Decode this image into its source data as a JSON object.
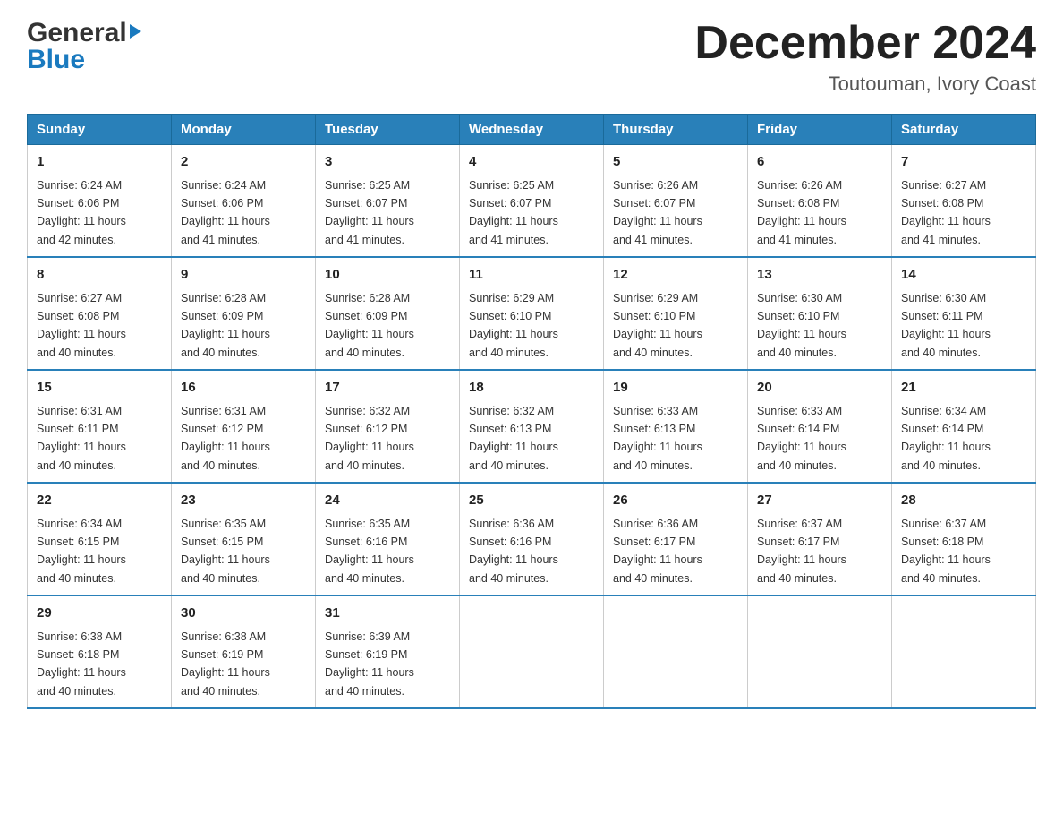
{
  "logo": {
    "general": "General",
    "blue": "Blue"
  },
  "header": {
    "month": "December 2024",
    "location": "Toutouman, Ivory Coast"
  },
  "weekdays": [
    "Sunday",
    "Monday",
    "Tuesday",
    "Wednesday",
    "Thursday",
    "Friday",
    "Saturday"
  ],
  "weeks": [
    [
      {
        "day": "1",
        "sunrise": "6:24 AM",
        "sunset": "6:06 PM",
        "daylight": "11 hours and 42 minutes."
      },
      {
        "day": "2",
        "sunrise": "6:24 AM",
        "sunset": "6:06 PM",
        "daylight": "11 hours and 41 minutes."
      },
      {
        "day": "3",
        "sunrise": "6:25 AM",
        "sunset": "6:07 PM",
        "daylight": "11 hours and 41 minutes."
      },
      {
        "day": "4",
        "sunrise": "6:25 AM",
        "sunset": "6:07 PM",
        "daylight": "11 hours and 41 minutes."
      },
      {
        "day": "5",
        "sunrise": "6:26 AM",
        "sunset": "6:07 PM",
        "daylight": "11 hours and 41 minutes."
      },
      {
        "day": "6",
        "sunrise": "6:26 AM",
        "sunset": "6:08 PM",
        "daylight": "11 hours and 41 minutes."
      },
      {
        "day": "7",
        "sunrise": "6:27 AM",
        "sunset": "6:08 PM",
        "daylight": "11 hours and 41 minutes."
      }
    ],
    [
      {
        "day": "8",
        "sunrise": "6:27 AM",
        "sunset": "6:08 PM",
        "daylight": "11 hours and 40 minutes."
      },
      {
        "day": "9",
        "sunrise": "6:28 AM",
        "sunset": "6:09 PM",
        "daylight": "11 hours and 40 minutes."
      },
      {
        "day": "10",
        "sunrise": "6:28 AM",
        "sunset": "6:09 PM",
        "daylight": "11 hours and 40 minutes."
      },
      {
        "day": "11",
        "sunrise": "6:29 AM",
        "sunset": "6:10 PM",
        "daylight": "11 hours and 40 minutes."
      },
      {
        "day": "12",
        "sunrise": "6:29 AM",
        "sunset": "6:10 PM",
        "daylight": "11 hours and 40 minutes."
      },
      {
        "day": "13",
        "sunrise": "6:30 AM",
        "sunset": "6:10 PM",
        "daylight": "11 hours and 40 minutes."
      },
      {
        "day": "14",
        "sunrise": "6:30 AM",
        "sunset": "6:11 PM",
        "daylight": "11 hours and 40 minutes."
      }
    ],
    [
      {
        "day": "15",
        "sunrise": "6:31 AM",
        "sunset": "6:11 PM",
        "daylight": "11 hours and 40 minutes."
      },
      {
        "day": "16",
        "sunrise": "6:31 AM",
        "sunset": "6:12 PM",
        "daylight": "11 hours and 40 minutes."
      },
      {
        "day": "17",
        "sunrise": "6:32 AM",
        "sunset": "6:12 PM",
        "daylight": "11 hours and 40 minutes."
      },
      {
        "day": "18",
        "sunrise": "6:32 AM",
        "sunset": "6:13 PM",
        "daylight": "11 hours and 40 minutes."
      },
      {
        "day": "19",
        "sunrise": "6:33 AM",
        "sunset": "6:13 PM",
        "daylight": "11 hours and 40 minutes."
      },
      {
        "day": "20",
        "sunrise": "6:33 AM",
        "sunset": "6:14 PM",
        "daylight": "11 hours and 40 minutes."
      },
      {
        "day": "21",
        "sunrise": "6:34 AM",
        "sunset": "6:14 PM",
        "daylight": "11 hours and 40 minutes."
      }
    ],
    [
      {
        "day": "22",
        "sunrise": "6:34 AM",
        "sunset": "6:15 PM",
        "daylight": "11 hours and 40 minutes."
      },
      {
        "day": "23",
        "sunrise": "6:35 AM",
        "sunset": "6:15 PM",
        "daylight": "11 hours and 40 minutes."
      },
      {
        "day": "24",
        "sunrise": "6:35 AM",
        "sunset": "6:16 PM",
        "daylight": "11 hours and 40 minutes."
      },
      {
        "day": "25",
        "sunrise": "6:36 AM",
        "sunset": "6:16 PM",
        "daylight": "11 hours and 40 minutes."
      },
      {
        "day": "26",
        "sunrise": "6:36 AM",
        "sunset": "6:17 PM",
        "daylight": "11 hours and 40 minutes."
      },
      {
        "day": "27",
        "sunrise": "6:37 AM",
        "sunset": "6:17 PM",
        "daylight": "11 hours and 40 minutes."
      },
      {
        "day": "28",
        "sunrise": "6:37 AM",
        "sunset": "6:18 PM",
        "daylight": "11 hours and 40 minutes."
      }
    ],
    [
      {
        "day": "29",
        "sunrise": "6:38 AM",
        "sunset": "6:18 PM",
        "daylight": "11 hours and 40 minutes."
      },
      {
        "day": "30",
        "sunrise": "6:38 AM",
        "sunset": "6:19 PM",
        "daylight": "11 hours and 40 minutes."
      },
      {
        "day": "31",
        "sunrise": "6:39 AM",
        "sunset": "6:19 PM",
        "daylight": "11 hours and 40 minutes."
      },
      null,
      null,
      null,
      null
    ]
  ],
  "labels": {
    "sunrise": "Sunrise:",
    "sunset": "Sunset:",
    "daylight": "Daylight:"
  }
}
